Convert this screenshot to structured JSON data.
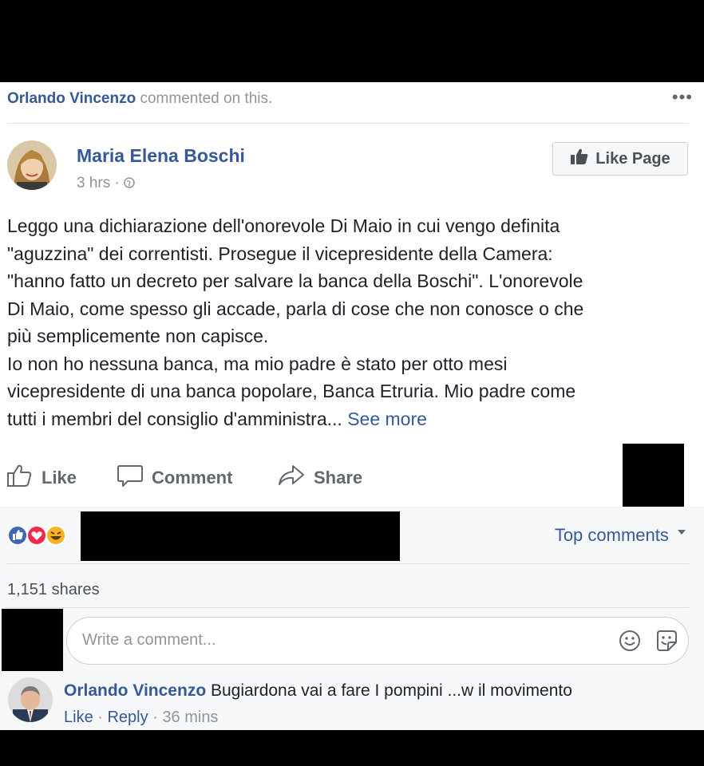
{
  "activity": {
    "actor": "Orlando Vincenzo",
    "action": "commented on this."
  },
  "post": {
    "author": "Maria Elena Boschi",
    "time": "3 hrs",
    "like_page_label": "Like Page",
    "text": "Leggo una dichiarazione dell'onorevole Di Maio in cui vengo definita\n\"aguzzina\" dei correntisti. Prosegue il vicepresidente della Camera:\n\"hanno fatto un decreto per salvare la banca della Boschi\". L'onorevole\nDi Maio, come spesso gli accade, parla di cose che non conosce o che\npiù semplicemente non capisce.\nIo non ho nessuna banca, ma mio padre è stato per otto mesi\nvicepresidente di una banca popolare, Banca Etruria. Mio padre come\ntutti i membri del consiglio d'amministra... ",
    "see_more": "See more"
  },
  "actions": {
    "like": "Like",
    "comment": "Comment",
    "share": "Share"
  },
  "feedback": {
    "top_comments": "Top comments",
    "shares": "1,151 shares"
  },
  "composer": {
    "placeholder": "Write a comment..."
  },
  "comment": {
    "author": "Orlando Vincenzo",
    "text": "Bugiardona vai a fare I pompini ...w il movimento",
    "like": "Like",
    "reply": "Reply",
    "time": "36 mins"
  },
  "colors": {
    "link": "#365899",
    "meta": "#90949c",
    "like_blue": "#4267b2",
    "love_red": "#f0284a",
    "haha_yellow": "#f7b125"
  },
  "icons": [
    "more-options-icon",
    "thumbs-up-icon",
    "globe-icon",
    "comment-bubble-icon",
    "share-arrow-icon",
    "caret-down-icon",
    "smiley-icon",
    "sticker-icon"
  ]
}
